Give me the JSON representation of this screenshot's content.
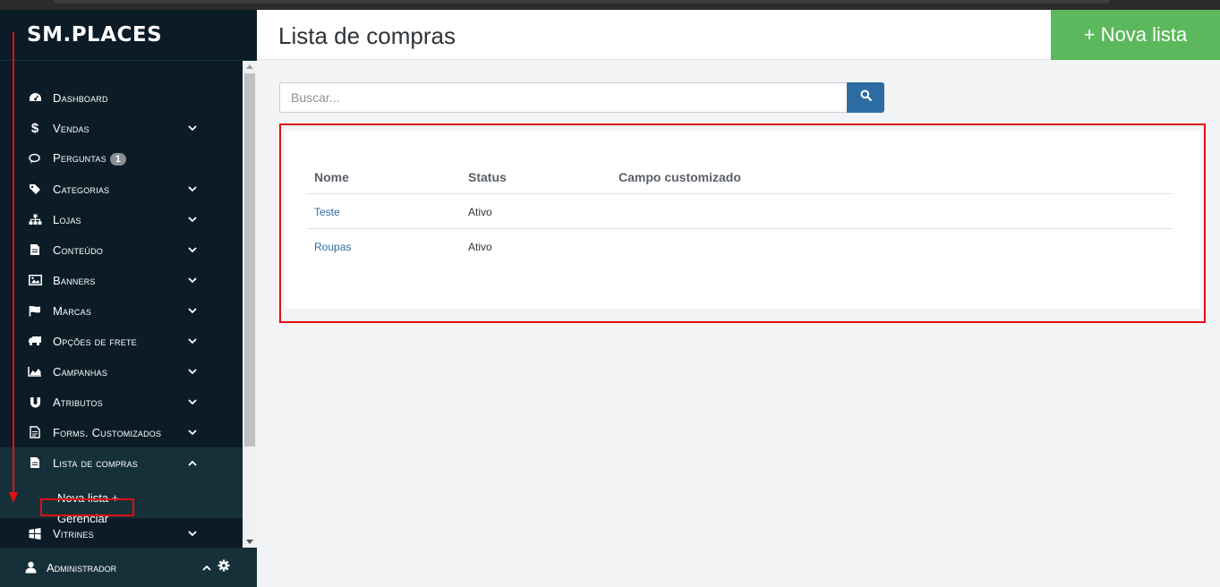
{
  "brand": {
    "logo_text": "SM.PLACES"
  },
  "sidebar": {
    "items": [
      {
        "label": "Dashboard",
        "icon": "dashboard-icon"
      },
      {
        "label": "Vendas",
        "icon": "dollar-icon"
      },
      {
        "label": "Perguntas",
        "icon": "comments-icon",
        "badge": "1"
      },
      {
        "label": "Categorias",
        "icon": "tags-icon"
      },
      {
        "label": "Lojas",
        "icon": "sitemap-icon"
      },
      {
        "label": "Conteúdo",
        "icon": "file-icon"
      },
      {
        "label": "Banners",
        "icon": "image-icon"
      },
      {
        "label": "Marcas",
        "icon": "flag-icon"
      },
      {
        "label": "Opções de frete",
        "icon": "truck-icon"
      },
      {
        "label": "Campanhas",
        "icon": "area-chart-icon"
      },
      {
        "label": "Atributos",
        "icon": "magnet-icon"
      },
      {
        "label": "Forms. Customizados",
        "icon": "form-icon"
      },
      {
        "label": "Lista de compras",
        "icon": "document-icon"
      },
      {
        "label": "Vitrines",
        "icon": "windows-icon"
      }
    ],
    "submenu": [
      {
        "label": "Nova lista +"
      },
      {
        "label": "Gerenciar"
      }
    ],
    "user": {
      "label": "Administrador"
    }
  },
  "header": {
    "title": "Lista de compras",
    "new_button_label": "+ Nova lista"
  },
  "search": {
    "placeholder": "Buscar..."
  },
  "table": {
    "columns": [
      "Nome",
      "Status",
      "Campo customizado"
    ],
    "rows": [
      {
        "nome": "Teste",
        "status": "Ativo",
        "campo": ""
      },
      {
        "nome": "Roupas",
        "status": "Ativo",
        "campo": ""
      }
    ]
  },
  "colors": {
    "sidebar_bg": "#0b1c26",
    "accent_green": "#5cb85c",
    "accent_blue": "#2d6ca2",
    "annotation_red": "#e01010"
  }
}
